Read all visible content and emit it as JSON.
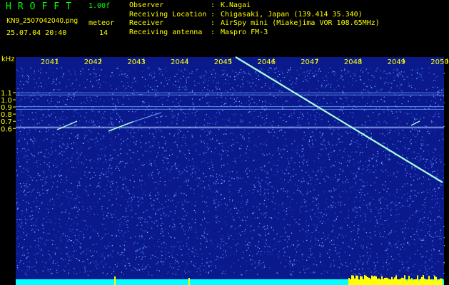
{
  "header": {
    "title": "HROFFT",
    "version": "1.00f",
    "filename": "KN9_2507042040.png",
    "mode": "meteor",
    "datetime": "25.07.04 20:40",
    "count": "14"
  },
  "meta": [
    {
      "key": "Observer",
      "sep": ":",
      "value": "K.Nagai"
    },
    {
      "key": "Receiving Location",
      "sep": ":",
      "value": "Chigasaki, Japan (139.414 35.340)"
    },
    {
      "key": "Receiver",
      "sep": ":",
      "value": "AirSpy mini (Miakejima VOR 108.65MHz)"
    },
    {
      "key": "Receiving antenna",
      "sep": ":",
      "value": "Maspro FM-3"
    }
  ],
  "chart_data": {
    "type": "heatmap",
    "ylabel": "kHz",
    "y_ticks": [
      "1.1",
      "1.0",
      "0.9",
      "0.8",
      "0.7",
      "0.6"
    ],
    "x_ticks": [
      "2041",
      "2042",
      "2043",
      "2044",
      "2045",
      "2046",
      "2047",
      "2048",
      "2049",
      "2050"
    ],
    "colors": {
      "background": "#0a1a8c",
      "noise": "#3d6cff",
      "trace": "#aaffdd",
      "bar": "#00ffff",
      "bar_active": "#ffff00"
    }
  }
}
